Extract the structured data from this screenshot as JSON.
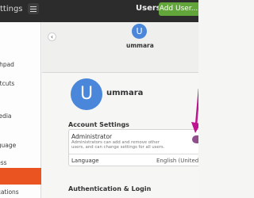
{
  "header": {
    "app_title": "ttings",
    "panel_title": "Users",
    "add_user_label": "Add User..."
  },
  "sidebar": {
    "items": [
      {
        "label": "tchpad",
        "active": false
      },
      {
        "label": "ortcuts",
        "active": false
      },
      {
        "label": "Media",
        "active": false
      },
      {
        "label": "nguage",
        "active": false
      },
      {
        "label": "cess",
        "active": false
      },
      {
        "label": "",
        "active": true
      },
      {
        "label": "fications",
        "active": false
      }
    ]
  },
  "carousel": {
    "prev_symbol": "‹",
    "avatar_initial": "U",
    "user_name": "ummara"
  },
  "profile": {
    "avatar_initial": "U",
    "user_name": "ummara"
  },
  "account_settings": {
    "section_title": "Account Settings",
    "administrator_label": "Administrator",
    "administrator_desc": "Administrators can add and remove other users, and can change settings for all users.",
    "administrator_enabled": true,
    "language_label": "Language",
    "language_value": "English (United States)"
  },
  "auth_section_title": "Authentication & Login",
  "colors": {
    "header_bg": "#2c2c2c",
    "accent": "#e95420",
    "add_button": "#62a53b",
    "avatar": "#4a86d9",
    "toggle_on": "#8e4f8a",
    "annotation_arrow": "#c0138f"
  }
}
